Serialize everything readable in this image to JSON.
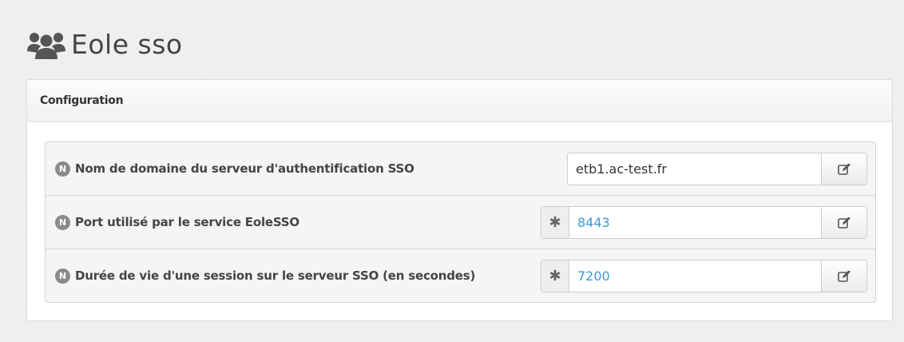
{
  "header": {
    "title": "Eole sso",
    "icon": "users-icon"
  },
  "panel": {
    "title": "Configuration",
    "rows": [
      {
        "badge": "N",
        "label": "Nom de domaine du serveur d'authentification SSO",
        "value": "etb1.ac-test.fr",
        "required": false
      },
      {
        "badge": "N",
        "label": "Port utilisé par le service EoleSSO",
        "value": "8443",
        "required": true,
        "required_glyph": "✱"
      },
      {
        "badge": "N",
        "label": "Durée de vie d'une session sur le serveur SSO (en secondes)",
        "value": "7200",
        "required": true,
        "required_glyph": "✱"
      }
    ]
  },
  "colors": {
    "value_blue": "#3a9ad9",
    "badge_gray": "#8a8a8a"
  }
}
